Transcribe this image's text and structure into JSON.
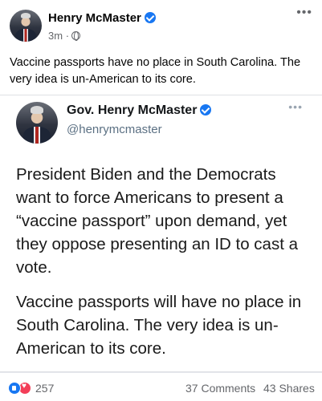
{
  "post": {
    "author": "Henry McMaster",
    "time": "3m",
    "separator": "·",
    "text": "Vaccine passports have no place in South Carolina. The very idea is un-American to its core.",
    "more_glyph": "•••"
  },
  "tweet": {
    "name": "Gov. Henry McMaster",
    "handle": "@henrymcmaster",
    "more_glyph": "•••",
    "paragraph1": "President Biden and the Democrats want to force Americans to present a “vaccine passport” upon demand, yet they oppose presenting an ID to cast a vote.",
    "paragraph2": "Vaccine passports will have no place in South Carolina. The very idea is un-American to its core."
  },
  "footer": {
    "reactions": "257",
    "comments": "37 Comments",
    "shares": "43 Shares"
  },
  "colors": {
    "verified": "#1877f2",
    "like": "#1877f2",
    "love": "#f33e58"
  },
  "icons": [
    "verified-icon",
    "globe-icon",
    "more-icon",
    "like-icon",
    "love-icon"
  ]
}
